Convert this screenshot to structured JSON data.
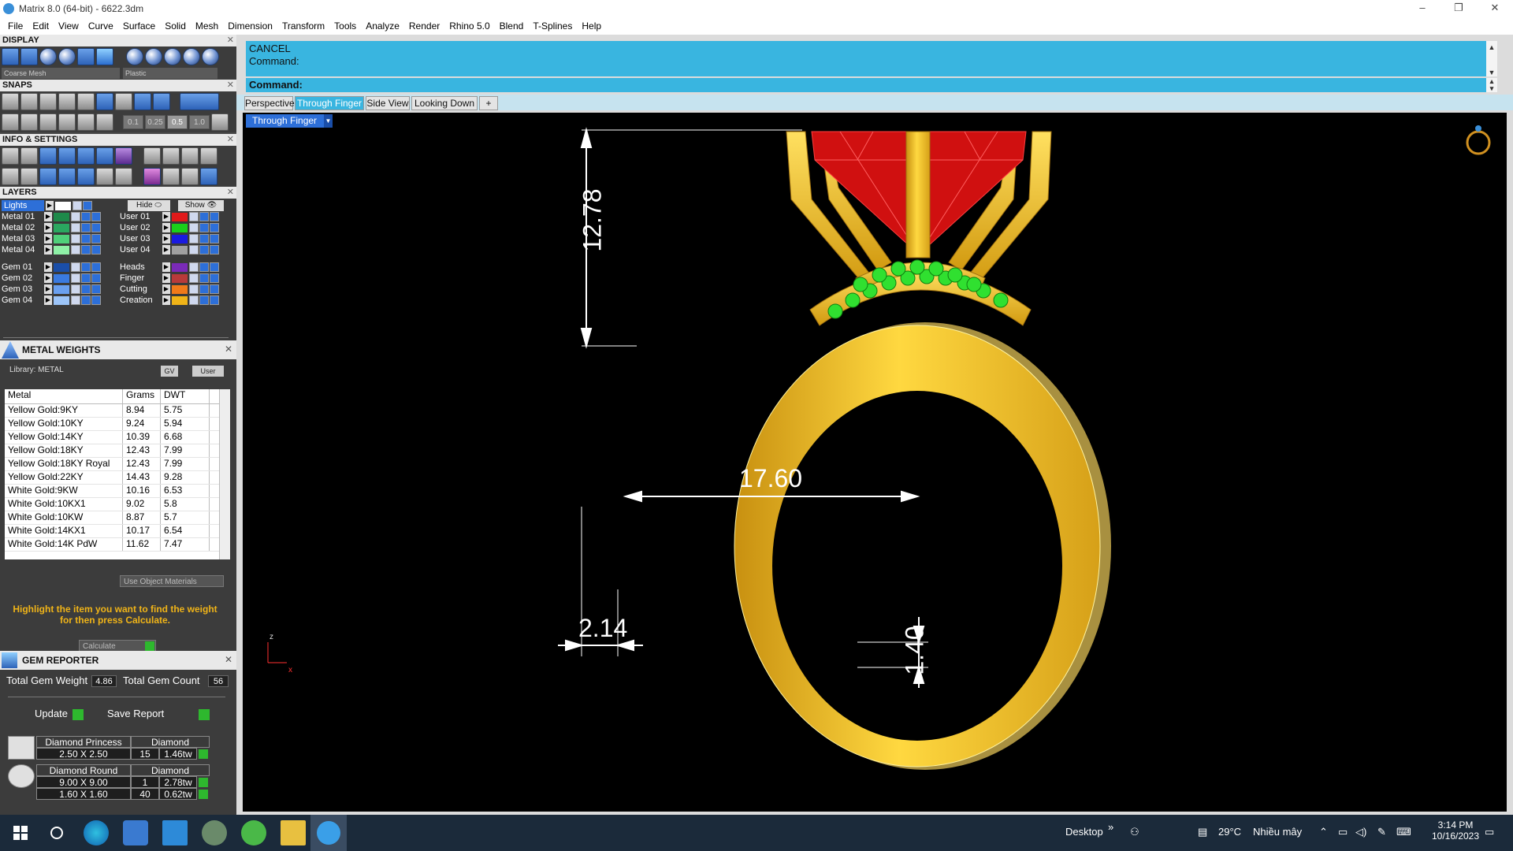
{
  "window": {
    "title": "Matrix 8.0 (64-bit) - 6622.3dm"
  },
  "menu": [
    "File",
    "Edit",
    "View",
    "Curve",
    "Surface",
    "Solid",
    "Mesh",
    "Dimension",
    "Transform",
    "Tools",
    "Analyze",
    "Render",
    "Rhino 5.0",
    "Blend",
    "T-Splines",
    "Help"
  ],
  "display": {
    "header": "DISPLAY",
    "mesh_select": "Coarse Mesh",
    "material_select": "Plastic"
  },
  "snaps": {
    "header": "SNAPS",
    "values": [
      "0.1",
      "0.25",
      "0.5",
      "1.0"
    ]
  },
  "info": {
    "header": "INFO & SETTINGS"
  },
  "layers": {
    "header": "LAYERS",
    "lights_label": "Lights",
    "hide_label": "Hide",
    "show_label": "Show",
    "left": [
      {
        "name": "Metal 01",
        "color": "#1e8a4a"
      },
      {
        "name": "Metal 02",
        "color": "#2aa860"
      },
      {
        "name": "Metal 03",
        "color": "#4fd07a"
      },
      {
        "name": "Metal 04",
        "color": "#8ef0a6"
      },
      {
        "name": "Gem 01",
        "color": "#1a4ea8"
      },
      {
        "name": "Gem 02",
        "color": "#3a7ae0"
      },
      {
        "name": "Gem 03",
        "color": "#6aa0f0"
      },
      {
        "name": "Gem 04",
        "color": "#9cc4f8"
      }
    ],
    "right": [
      {
        "name": "User 01",
        "color": "#e01a1a"
      },
      {
        "name": "User 02",
        "color": "#1ad01a"
      },
      {
        "name": "User 03",
        "color": "#1a1ae0"
      },
      {
        "name": "User 04",
        "color": "#a0a0a0"
      },
      {
        "name": "Heads",
        "color": "#7a2ab8"
      },
      {
        "name": "Finger",
        "color": "#b83a3a"
      },
      {
        "name": "Cutting",
        "color": "#f07a1a"
      },
      {
        "name": "Creation",
        "color": "#f0b418"
      }
    ]
  },
  "metal_weights": {
    "header": "METAL WEIGHTS",
    "library": "Library: METAL",
    "gv": "GV",
    "user": "User",
    "columns": [
      "Metal",
      "Grams",
      "DWT"
    ],
    "rows": [
      [
        "Yellow Gold:9KY",
        "8.94",
        "5.75"
      ],
      [
        "Yellow Gold:10KY",
        "9.24",
        "5.94"
      ],
      [
        "Yellow Gold:14KY",
        "10.39",
        "6.68"
      ],
      [
        "Yellow Gold:18KY",
        "12.43",
        "7.99"
      ],
      [
        "Yellow Gold:18KY Royal",
        "12.43",
        "7.99"
      ],
      [
        "Yellow Gold:22KY",
        "14.43",
        "9.28"
      ],
      [
        "White Gold:9KW",
        "10.16",
        "6.53"
      ],
      [
        "White Gold:10KX1",
        "9.02",
        "5.8"
      ],
      [
        "White Gold:10KW",
        "8.87",
        "5.7"
      ],
      [
        "White Gold:14KX1",
        "10.17",
        "6.54"
      ],
      [
        "White Gold:14K PdW",
        "11.62",
        "7.47"
      ]
    ],
    "use_object_materials": "Use Object Materials",
    "hint": "Highlight the item you want to find the weight for then press Calculate.",
    "calculate": "Calculate"
  },
  "gem_reporter": {
    "header": "GEM REPORTER",
    "total_weight_label": "Total Gem Weight",
    "total_weight": "4.86",
    "total_count_label": "Total Gem Count",
    "total_count": "56",
    "update": "Update",
    "save_report": "Save Report",
    "groups": [
      {
        "shape": "Diamond Princess",
        "material": "Diamond",
        "rows": [
          [
            "2.50 X 2.50",
            "15",
            "1.46tw"
          ]
        ]
      },
      {
        "shape": "Diamond Round",
        "material": "Diamond",
        "rows": [
          [
            "9.00 X 9.00",
            "1",
            "2.78tw"
          ],
          [
            "1.60 X 1.60",
            "40",
            "0.62tw"
          ]
        ]
      }
    ]
  },
  "command": {
    "line1": "CANCEL",
    "line2": "Command:",
    "prompt": "Command:"
  },
  "tabs": [
    "Perspective",
    "Through Finger",
    "Side View",
    "Looking Down",
    "+"
  ],
  "active_tab": "Through Finger",
  "viewport": {
    "label": "Through Finger",
    "axis_z": "z",
    "axis_x": "x"
  },
  "dimensions": {
    "height": "12.78",
    "inner": "17.60",
    "shank_width": "2.14",
    "shank_thickness": "1.40"
  },
  "taskbar": {
    "desktop": "Desktop",
    "weather": "29°C",
    "weather_text": "Nhiều mây",
    "time": "3:14 PM",
    "date": "10/16/2023"
  }
}
